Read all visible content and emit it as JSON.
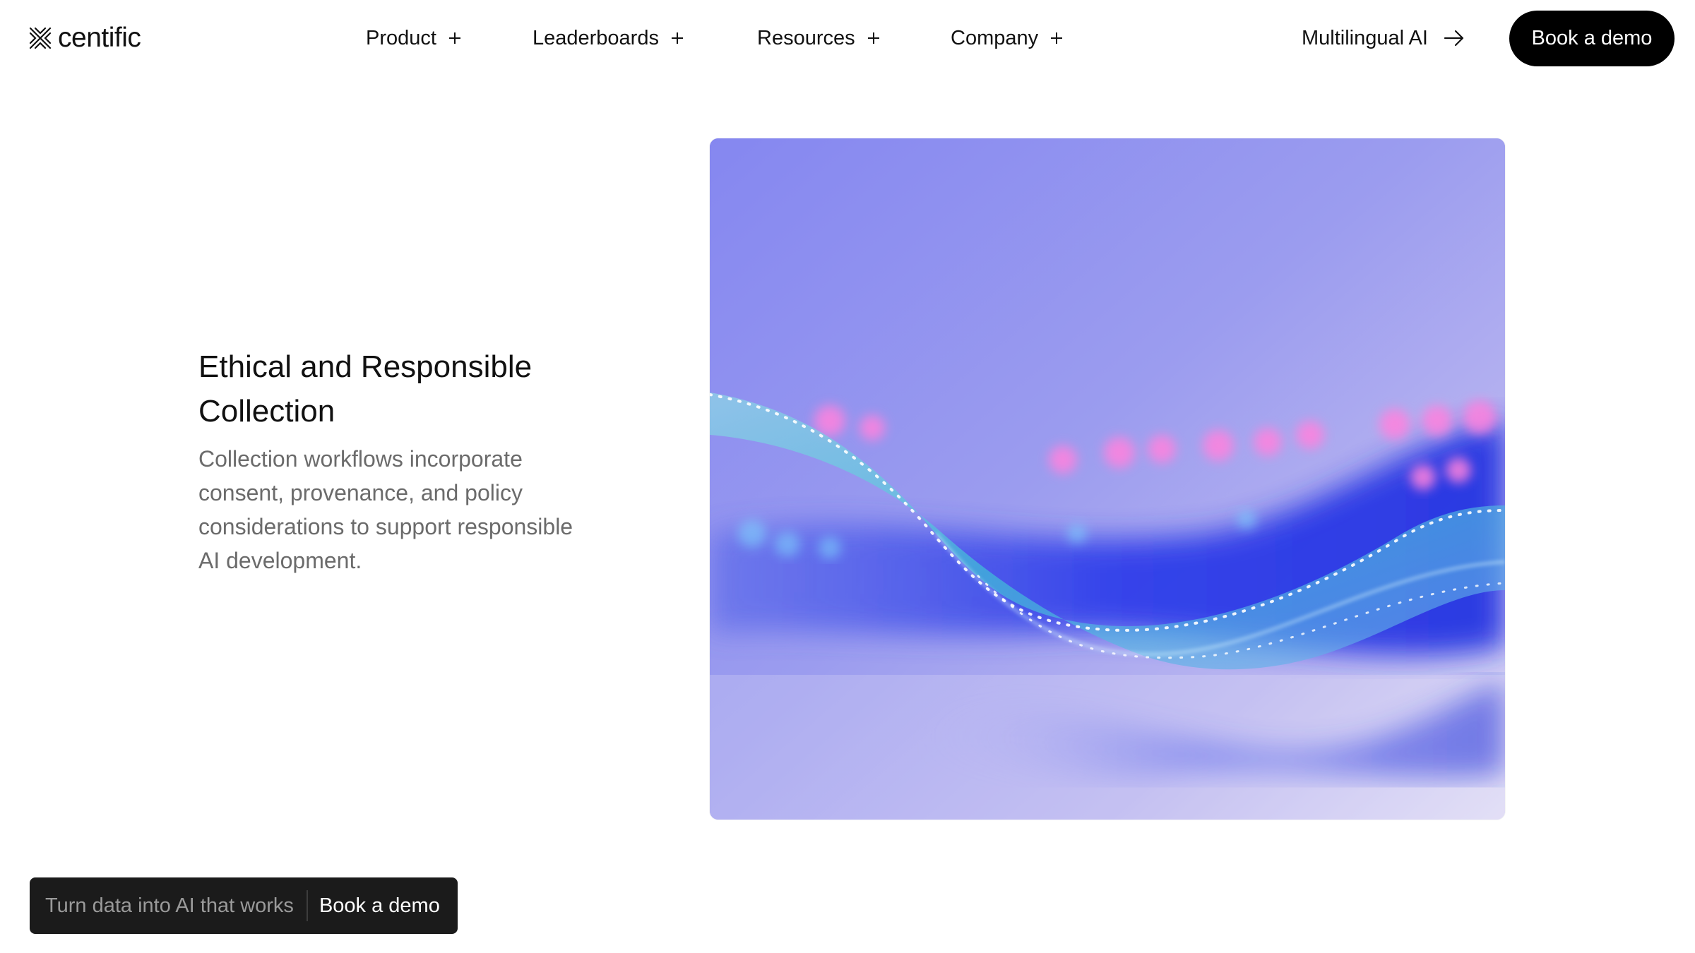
{
  "brand": {
    "logo_icon": "centific-x-logo-icon",
    "name": "centific"
  },
  "nav": {
    "items": [
      {
        "label": "Product",
        "icon": "plus-icon"
      },
      {
        "label": "Leaderboards",
        "icon": "plus-icon"
      },
      {
        "label": "Resources",
        "icon": "plus-icon"
      },
      {
        "label": "Company",
        "icon": "plus-icon"
      }
    ],
    "multilingual_link": {
      "label": "Multilingual AI",
      "icon": "arrow-right-icon"
    },
    "cta_button": "Book a demo"
  },
  "feature": {
    "title": "Ethical and Responsible Collection",
    "description": "Collection workflows incorporate consent, provenance, and policy considerations to support responsible AI development."
  },
  "hero_image": {
    "subject": "abstract-glass-wave-image"
  },
  "floating_cta": {
    "text": "Turn data into AI that works",
    "link": "Book a demo"
  },
  "colors": {
    "primary_button": "#000000",
    "cta_bar": "#1b1b1b",
    "body_muted_text": "#6b6b6b",
    "hero_violet": "#8d8ff0",
    "hero_blue": "#2b3ee8",
    "hero_pink": "#ff7ad9"
  }
}
